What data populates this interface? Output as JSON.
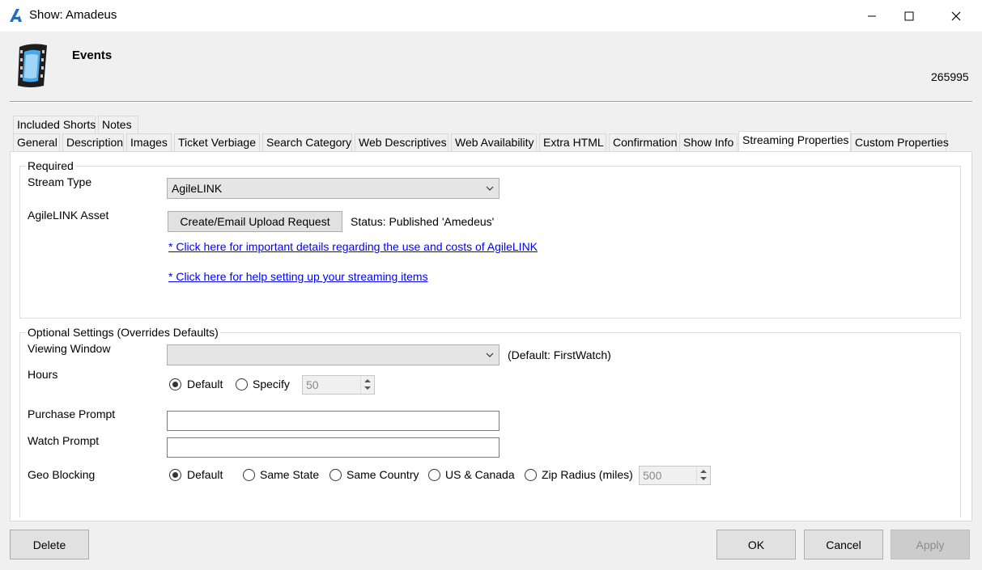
{
  "window": {
    "title": "Show: Amadeus"
  },
  "header": {
    "title": "Events",
    "id": "265995"
  },
  "tabs_row1": [
    "Included Shorts",
    "Notes"
  ],
  "tabs_row2": [
    "General",
    "Description",
    "Images",
    "Ticket Verbiage",
    "Search Category",
    "Web Descriptives",
    "Web Availability",
    "Extra HTML",
    "Confirmation",
    "Show Info",
    "Streaming Properties",
    "Custom Properties"
  ],
  "active_tab": "Streaming Properties",
  "required": {
    "legend": "Required",
    "stream_type_label": "Stream Type",
    "stream_type_value": "AgileLINK",
    "asset_label": "AgileLINK Asset",
    "upload_button": "Create/Email Upload Request",
    "status": "Status: Published 'Amedeus'",
    "link_details": "* Click here for important details regarding the use and costs of AgileLINK",
    "link_help": "* Click here for help setting up your streaming items"
  },
  "optional": {
    "legend": "Optional Settings (Overrides Defaults)",
    "viewing_window_label": "Viewing Window",
    "viewing_window_value": "",
    "viewing_window_default": "(Default: FirstWatch)",
    "hours_label": "Hours",
    "hours_default": "Default",
    "hours_specify": "Specify",
    "hours_value": "50",
    "purchase_prompt_label": "Purchase Prompt",
    "purchase_prompt_value": "",
    "watch_prompt_label": "Watch Prompt",
    "watch_prompt_value": "",
    "geo_label": "Geo Blocking",
    "geo_options": [
      "Default",
      "Same State",
      "Same Country",
      "US & Canada",
      "Zip Radius (miles)"
    ],
    "zip_radius_value": "500"
  },
  "buttons": {
    "delete": "Delete",
    "ok": "OK",
    "cancel": "Cancel",
    "apply": "Apply"
  },
  "icons": {
    "app": "agile-logo-icon",
    "header": "film-strip-icon"
  },
  "colors": {
    "link": "#0000ff",
    "app_icon": "#1f6fc5"
  }
}
